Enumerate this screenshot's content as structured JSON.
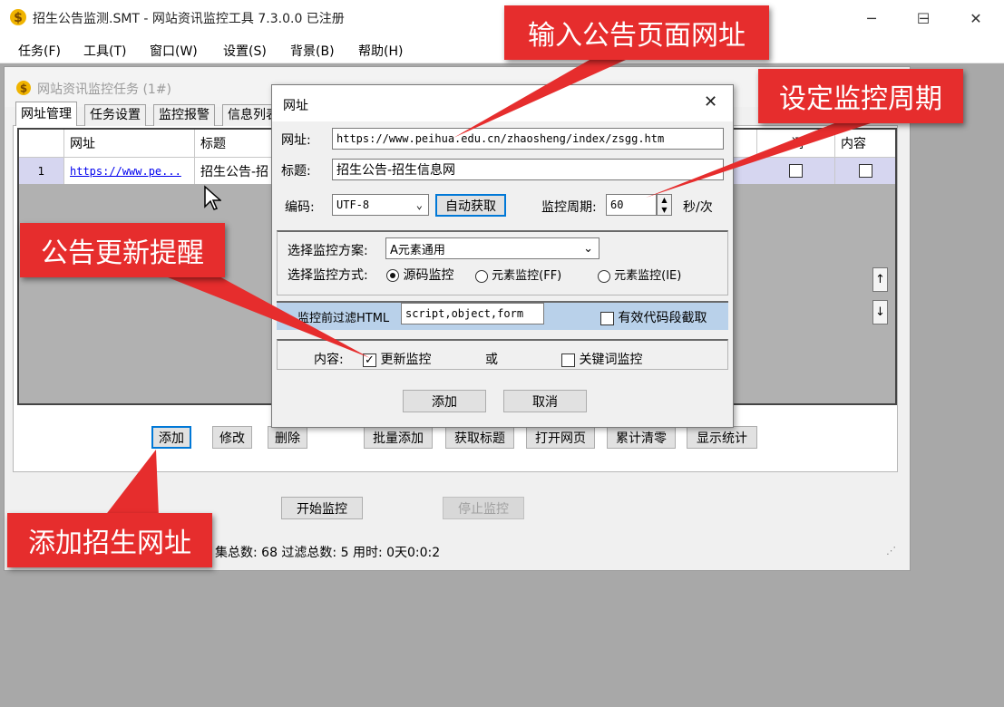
{
  "window": {
    "title": "招生公告监测.SMT  - 网站资讯监控工具 7.3.0.0  已注册",
    "minimize": "─",
    "maximize": "☐",
    "close": "✕"
  },
  "menu": [
    "任务(F)",
    "工具(T)",
    "窗口(W)",
    "设置(S)",
    "背景(B)",
    "帮助(H)"
  ],
  "task_window": {
    "title": "网站资讯监控任务 (1#)",
    "tabs": [
      "网址管理",
      "任务设置",
      "监控报警",
      "信息列表"
    ],
    "columns": [
      "网址",
      "标题",
      "词",
      "内容"
    ],
    "row": {
      "num": "1",
      "url": "https://www.pe...",
      "title": "招生公告-招"
    },
    "up_arrow": "↑",
    "down_arrow": "↓",
    "buttons": [
      "添加",
      "修改",
      "删除",
      "批量添加",
      "获取标题",
      "打开网页",
      "累计清零",
      "显示统计"
    ],
    "start": "开始监控",
    "stop": "停止监控",
    "status": "集总数:  68   过滤总数:  5   用时:  0天0:0:2"
  },
  "dialog": {
    "title": "网址",
    "close": "✕",
    "url_label": "网址:",
    "url_value": "https://www.peihua.edu.cn/zhaosheng/index/zsgg.htm",
    "title_label": "标题:",
    "title_value": "招生公告-招生信息网",
    "encoding_label": "编码:",
    "encoding_value": "UTF-8",
    "auto_button": "自动获取",
    "period_label": "监控周期:",
    "period_value": "60",
    "period_unit": "秒/次",
    "scheme_label": "选择监控方案:",
    "scheme_value": "A元素通用",
    "mode_label": "选择监控方式:",
    "modes": [
      "源码监控",
      "元素监控(FF)",
      "元素监控(IE)"
    ],
    "filter_label": "监控前过滤HTML",
    "filter_value": "script,object,form",
    "snippet_label": "有效代码段截取",
    "content_label": "内容:",
    "update_label": "更新监控",
    "or_label": "或",
    "keyword_label": "关键词监控",
    "add_button": "添加",
    "cancel_button": "取消"
  },
  "annotations": {
    "url": "输入公告页面网址",
    "period": "设定监控周期",
    "reminder": "公告更新提醒",
    "add": "添加招生网址"
  },
  "colors": {
    "callout": "#e62d2d",
    "selected_row": "#d6d6f0",
    "focus": "#0078d7"
  }
}
